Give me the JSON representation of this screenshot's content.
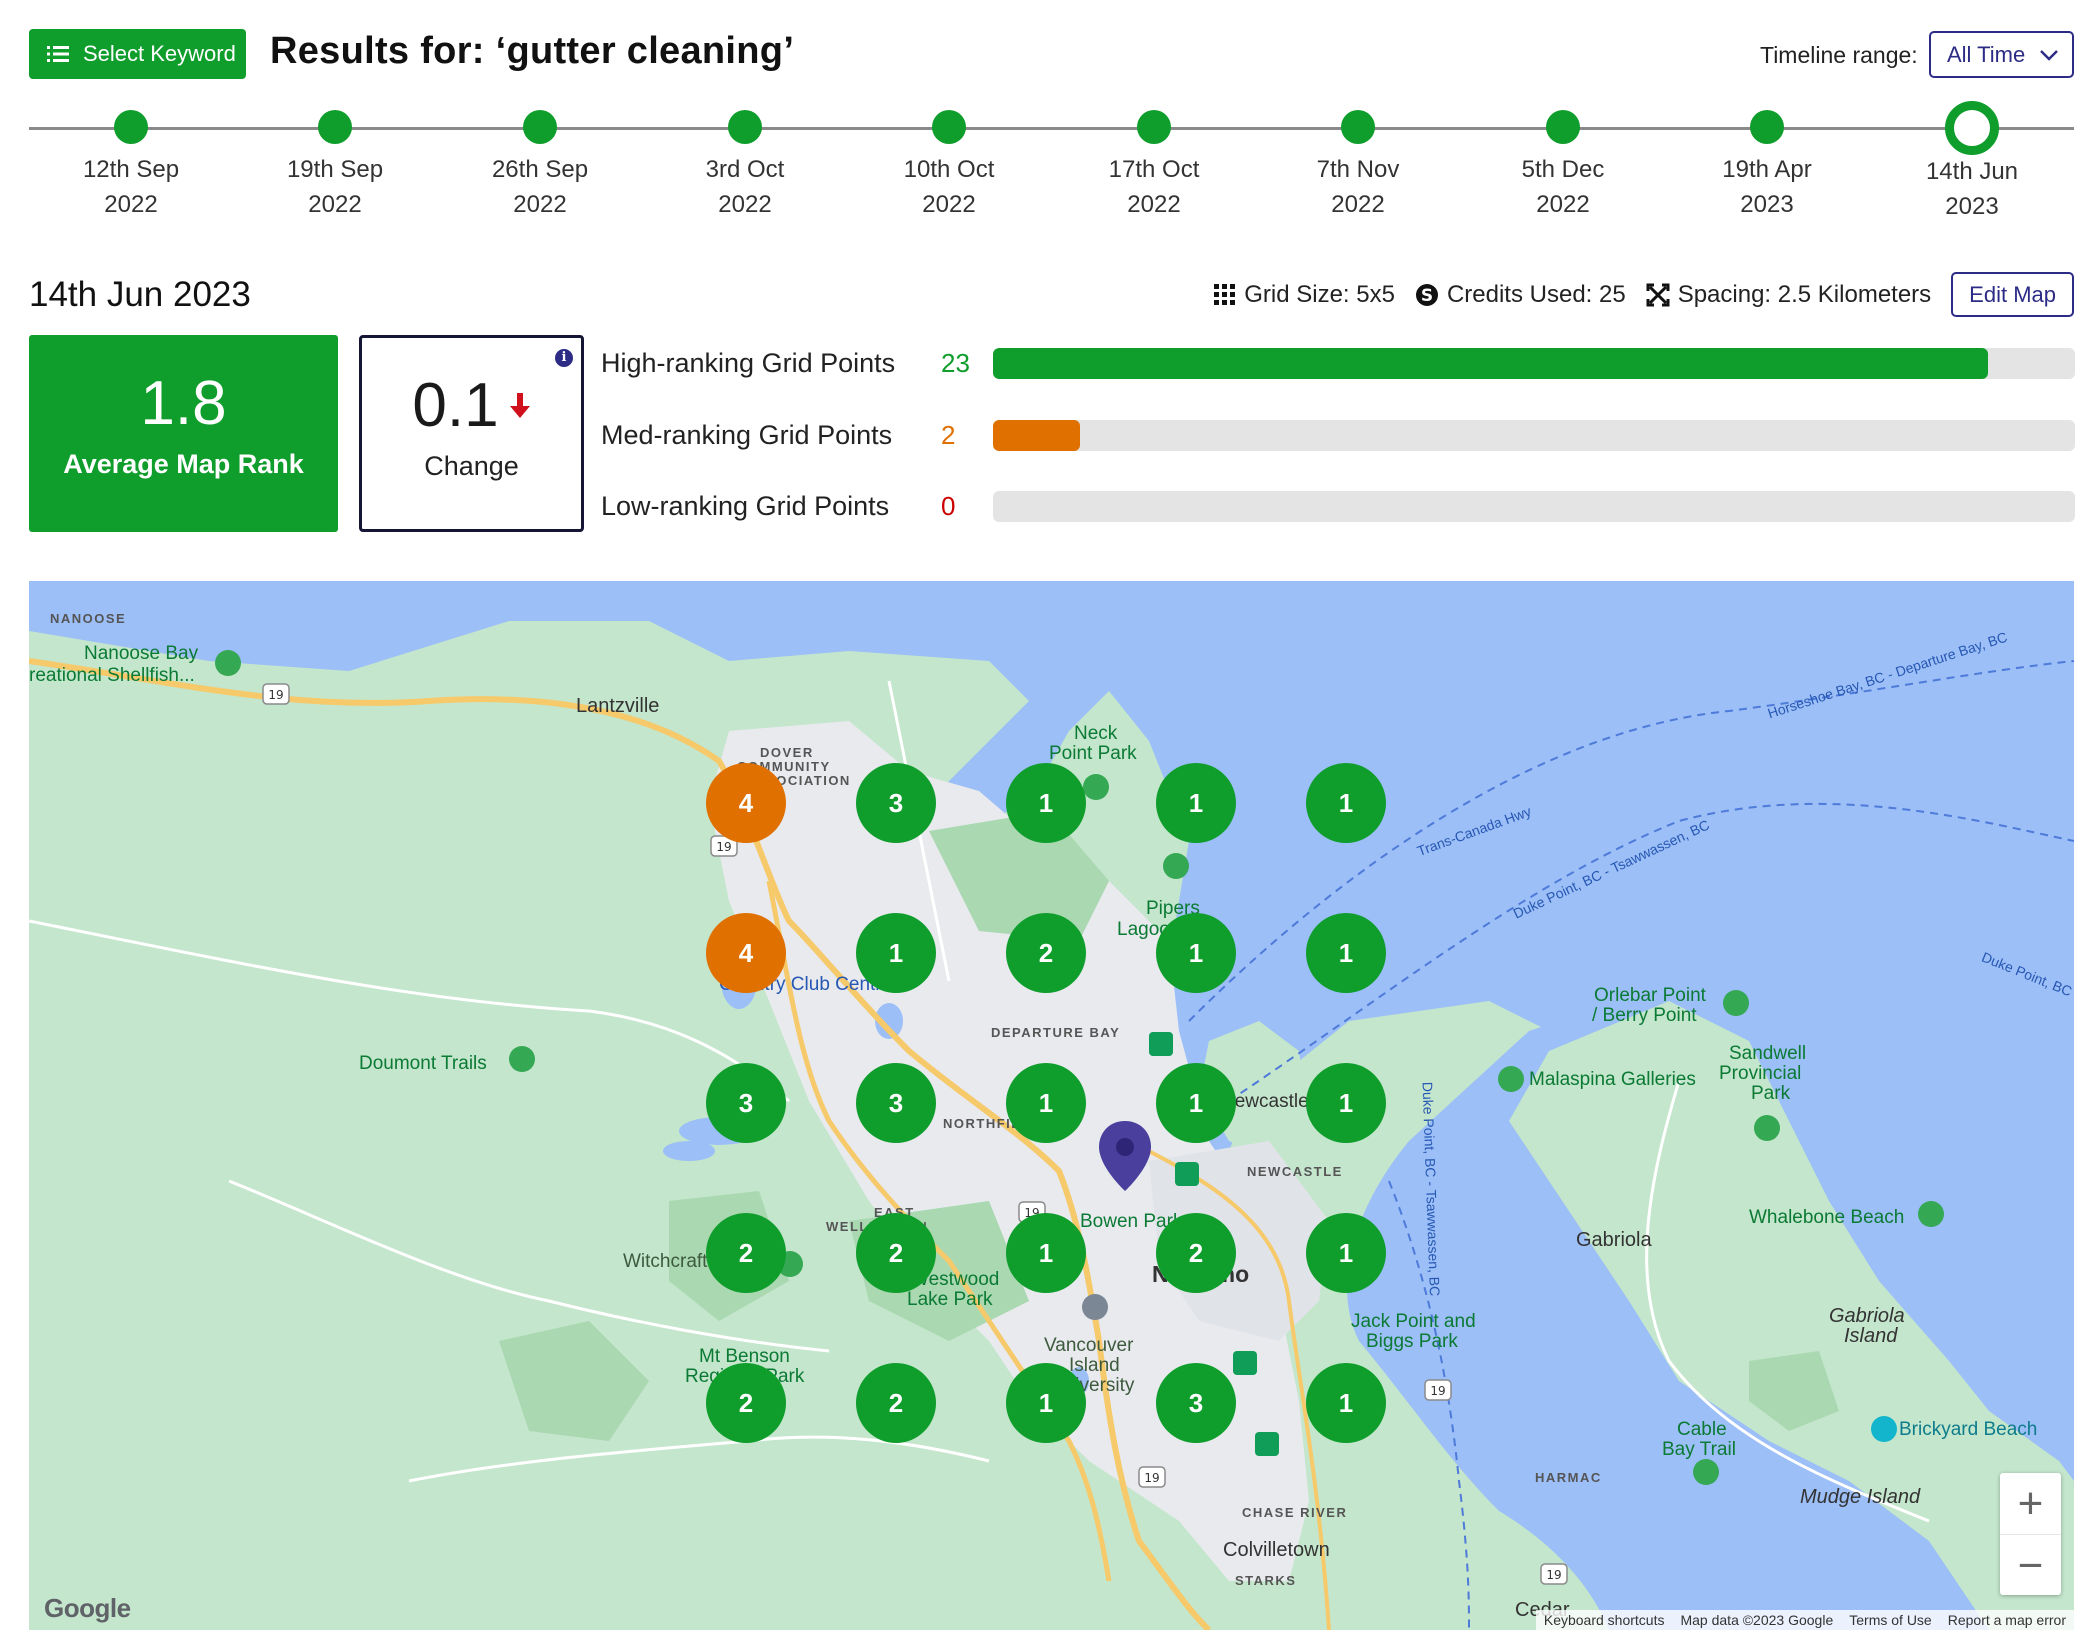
{
  "header": {
    "select_button_label": "Select Keyword",
    "title": "Results for: ‘gutter cleaning’",
    "timeline_range_label": "Timeline range:",
    "timeline_range_value": "All Time"
  },
  "timeline": [
    {
      "day": "12th Sep",
      "year": "2022"
    },
    {
      "day": "19th Sep",
      "year": "2022"
    },
    {
      "day": "26th Sep",
      "year": "2022"
    },
    {
      "day": "3rd Oct",
      "year": "2022"
    },
    {
      "day": "10th Oct",
      "year": "2022"
    },
    {
      "day": "17th Oct",
      "year": "2022"
    },
    {
      "day": "7th Nov",
      "year": "2022"
    },
    {
      "day": "5th Dec",
      "year": "2022"
    },
    {
      "day": "19th Apr",
      "year": "2023"
    },
    {
      "day": "14th Jun",
      "year": "2023",
      "active": true
    }
  ],
  "summary": {
    "date": "14th Jun 2023",
    "grid_size": "Grid Size: 5x5",
    "credits": "Credits Used: 25",
    "spacing": "Spacing: 2.5 Kilometers",
    "edit_map_label": "Edit Map",
    "average_rank": "1.8",
    "average_rank_label": "Average Map Rank",
    "change_value": "0.1",
    "change_label": "Change",
    "change_direction": "down"
  },
  "rankings": [
    {
      "label": "High-ranking Grid Points",
      "count": "23",
      "fraction": 0.92,
      "color": "#0f9d2c"
    },
    {
      "label": "Med-ranking Grid Points",
      "count": "2",
      "fraction": 0.08,
      "color": "#e07000"
    },
    {
      "label": "Low-ranking Grid Points",
      "count": "0",
      "fraction": 0.0,
      "color": "#cc0000"
    }
  ],
  "grid": [
    [
      4,
      3,
      1,
      1,
      1
    ],
    [
      4,
      1,
      2,
      1,
      1
    ],
    [
      3,
      3,
      1,
      1,
      1
    ],
    [
      2,
      2,
      1,
      2,
      1
    ],
    [
      2,
      2,
      1,
      3,
      1
    ]
  ],
  "colors": {
    "high": "#0f9d2c",
    "med": "#e07000",
    "accent": "#2c2c86"
  },
  "map": {
    "labels": {
      "nanoose": "NANOOSE",
      "nanoose_bay1": "Nanoose Bay",
      "nanoose_bay2": "reational Shellfish...",
      "lantzville": "Lantzville",
      "dover1": "DOVER",
      "dover2": "COMMUNITY",
      "dover3": "ASSOCIATION",
      "neck1": "Neck",
      "neck2": "Point Park",
      "pipers1": "Pipers",
      "pipers2": "Lagoon Park",
      "departure_bay": "DEPARTURE BAY",
      "country_club": "Country Club Centre",
      "doumont": "Doumont Trails",
      "northfield": "NORTHFIELD",
      "newcastle": "NEWCASTLE",
      "newcastle_island": "Newcastle Island",
      "east_wellington1": "EAST",
      "east_wellington2": "WELLINGTON",
      "bowen_park": "Bowen Park",
      "nanaimo": "Nanaimo",
      "witchcraft": "Witchcraft",
      "westwood1": "Westwood",
      "westwood2": "Lake Park",
      "mt_benson1": "Mt Benson",
      "mt_benson2": "Regional Park",
      "viu1": "Vancouver",
      "viu2": "Island",
      "viu3": "University",
      "chase_river": "CHASE RIVER",
      "colvilletown": "Colvilletown",
      "starks": "STARKS",
      "cedar": "Cedar",
      "harmac": "HARMAC",
      "jack_point1": "Jack Point and",
      "jack_point2": "Biggs Park",
      "cable_bay1": "Cable",
      "cable_bay2": "Bay Trail",
      "gabriola": "Gabriola",
      "gabriola_island1": "Gabriola",
      "gabriola_island2": "Island",
      "mudge": "Mudge Island",
      "brickyard": "Brickyard Beach",
      "whalebone": "Whalebone Beach",
      "malaspina": "Malaspina Galleries",
      "sandwell1": "Sandwell",
      "sandwell2": "Provincial",
      "sandwell3": "Park",
      "orlebar1": "Orlebar Point",
      "orlebar2": "/ Berry Point",
      "trans_canada": "Trans-Canada Hwy",
      "horseshoe": "Horseshoe Bay, BC - Departure Bay, BC",
      "duke_point1": "Duke Point, BC - Tsawwassen, BC",
      "duke_point2": "Duke Point, BC",
      "duke_point3": "Duke Point, BC - Tsawwassen, BC",
      "hwy19": "19"
    },
    "attribution": [
      "Keyboard shortcuts",
      "Map data ©2023 Google",
      "Terms of Use",
      "Report a map error"
    ],
    "google_logo": "Google",
    "zoom_in": "+",
    "zoom_out": "−"
  }
}
